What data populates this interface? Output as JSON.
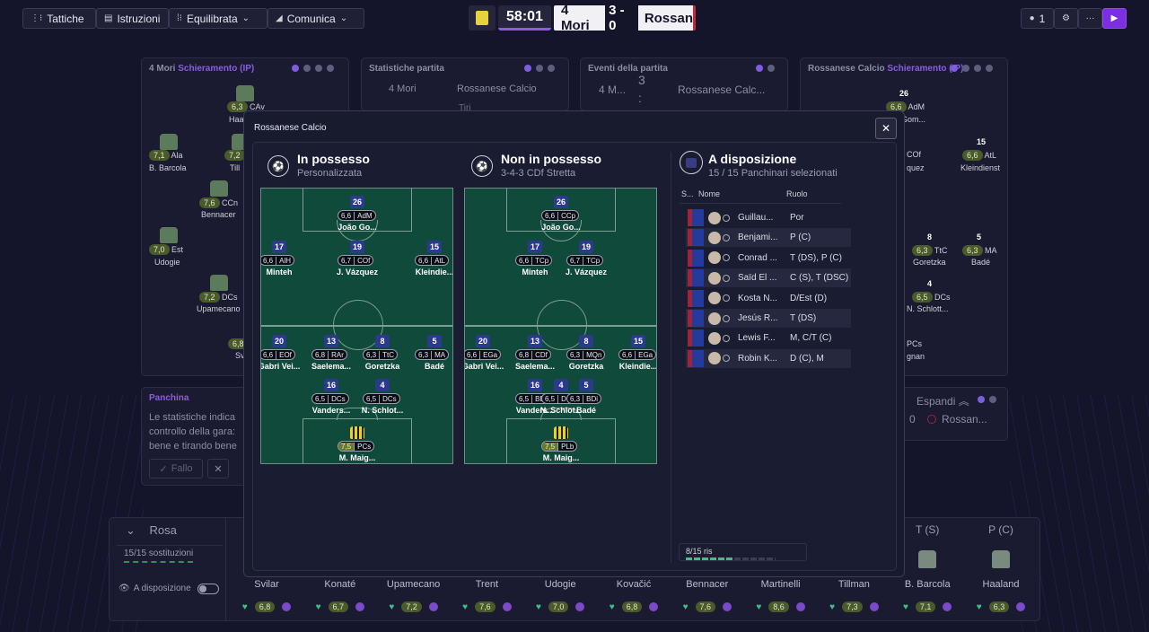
{
  "toolbar": {
    "tactics": "Tattiche",
    "instructions": "Istruzioni",
    "mentality": "Equilibrata",
    "communicate": "Comunica"
  },
  "match": {
    "clock": "58:01",
    "home": "4 Mori",
    "score": "3 - 0",
    "away": "Rossan",
    "users": "1"
  },
  "bg_panels": {
    "home_lineup_team": "4 Mori",
    "home_lineup_title": "Schieramento (IP)",
    "stats_title": "Statistiche partita",
    "stats_home": "4 Mori",
    "stats_away": "Rossanese Calcio",
    "stats_row": "Tiri",
    "events_title": "Eventi della partita",
    "events_home": "4 M...",
    "events_score": "3 : 0",
    "events_away": "Rossanese Calc...",
    "away_lineup_team": "Rossanese Calcio",
    "away_lineup_title": "Schieramento (IP)",
    "bench_title": "Panchina",
    "bench_text": "Le statistiche indica controllo della gara: bene e tirando bene",
    "foul_button": "Fallo",
    "expand": "Espandi",
    "mini_score": "0",
    "mini_team": "Rossan...",
    "home_players": [
      {
        "rating": "6,3",
        "role": "CAv",
        "name": "Haa"
      },
      {
        "rating": "7,1",
        "role": "Ala",
        "name": "B. Barcola"
      },
      {
        "rating": "7,2",
        "role": "Ala",
        "name": "Till"
      },
      {
        "rating": "7,6",
        "role": "CCn",
        "name": "Bennacer"
      },
      {
        "rating": "7,0",
        "role": "Est",
        "name": "Udogie"
      },
      {
        "rating": "7,2",
        "role": "DCs",
        "name": "Upamecano"
      },
      {
        "rating": "6,8",
        "role": "",
        "name": "Sv"
      }
    ],
    "away_players": [
      {
        "rating": "6,6",
        "role": "AdM",
        "name": "Gom...",
        "num": "26"
      },
      {
        "rating": "",
        "role": "COf",
        "name": "quez",
        "num": ""
      },
      {
        "rating": "6,6",
        "role": "AtL",
        "name": "Kleindienst",
        "num": "15"
      },
      {
        "rating": "6,3",
        "role": "TtC",
        "name": "Goretzka",
        "num": "8"
      },
      {
        "rating": "6,3",
        "role": "MA",
        "name": "Badé",
        "num": "5"
      },
      {
        "rating": "6,5",
        "role": "DCs",
        "name": "N. Schlott...",
        "num": "4"
      },
      {
        "rating": "",
        "role": "PCs",
        "name": "gnan",
        "num": ""
      }
    ]
  },
  "modal": {
    "team": "Rossanese Calcio",
    "in_possession": {
      "title": "In possesso",
      "subtitle": "Personalizzata"
    },
    "out_possession": {
      "title": "Non in possesso",
      "subtitle": "3-4-3 CDf Stretta"
    },
    "available": {
      "title": "A disposizione",
      "subtitle": "15 / 15 Panchinari selezionati"
    },
    "table_headers": {
      "shirt": "S...",
      "name": "Nome",
      "role": "Ruolo"
    },
    "subs": [
      {
        "name": "Guillau...",
        "role": "Por"
      },
      {
        "name": "Benjami...",
        "role": "P (C)"
      },
      {
        "name": "Conrad ...",
        "role": "T (DS), P (C)"
      },
      {
        "name": "Saïd El ...",
        "role": "C (S), T (DSC)"
      },
      {
        "name": "Kosta N...",
        "role": "D/Est (D)"
      },
      {
        "name": "Jesús R...",
        "role": "T (DS)"
      },
      {
        "name": "Lewis F...",
        "role": "M, C/T (C)"
      },
      {
        "name": "Robin K...",
        "role": "D (C), M"
      }
    ],
    "reserve_label": "8/15 ris",
    "reserve_fill": 0.53,
    "pitch_in": [
      {
        "num": "26",
        "rating": "6,6",
        "role": "AdM",
        "name": "João Go..."
      },
      {
        "num": "17",
        "rating": "6,6",
        "role": "AlH",
        "name": "Minteh"
      },
      {
        "num": "19",
        "rating": "6,7",
        "role": "COf",
        "name": "J. Vázquez"
      },
      {
        "num": "15",
        "rating": "6,6",
        "role": "AtL",
        "name": "Kleindie..."
      },
      {
        "num": "20",
        "rating": "6,6",
        "role": "EOf",
        "name": "Gabri Vei..."
      },
      {
        "num": "13",
        "rating": "6,8",
        "role": "RAr",
        "name": "Saelema..."
      },
      {
        "num": "8",
        "rating": "6,3",
        "role": "TtC",
        "name": "Goretzka"
      },
      {
        "num": "5",
        "rating": "6,3",
        "role": "MA",
        "name": "Badé"
      },
      {
        "num": "16",
        "rating": "6,5",
        "role": "DCs",
        "name": "Vanders..."
      },
      {
        "num": "4",
        "rating": "6,5",
        "role": "DCs",
        "name": "N. Schlot..."
      },
      {
        "num": "",
        "rating": "7,5",
        "role": "PCs",
        "name": "M. Maig..."
      }
    ],
    "pitch_out": [
      {
        "num": "26",
        "rating": "6,6",
        "role": "CCp",
        "name": "João Go..."
      },
      {
        "num": "17",
        "rating": "6,6",
        "role": "TCp",
        "name": "Minteh"
      },
      {
        "num": "19",
        "rating": "6,7",
        "role": "TCp",
        "name": "J. Vázquez"
      },
      {
        "num": "20",
        "rating": "6,6",
        "role": "EGa",
        "name": "Gabri Vei..."
      },
      {
        "num": "13",
        "rating": "6,8",
        "role": "CDf",
        "name": "Saelema..."
      },
      {
        "num": "8",
        "rating": "6,3",
        "role": "MQn",
        "name": "Goretzka"
      },
      {
        "num": "15",
        "rating": "6,6",
        "role": "EGa",
        "name": "Kleindie..."
      },
      {
        "num": "16",
        "rating": "6,5",
        "role": "BDi",
        "name": "Vanders..."
      },
      {
        "num": "4",
        "rating": "6,5",
        "role": "DC",
        "name": "N. Schlot..."
      },
      {
        "num": "5",
        "rating": "6,3",
        "role": "BDi",
        "name": "Badé"
      },
      {
        "num": "",
        "rating": "7,5",
        "role": "PLb",
        "name": "M. Maig..."
      }
    ]
  },
  "squad": {
    "title": "Rosa",
    "subs_used": "15/15 sostituzioni",
    "available_toggle": "A disposizione",
    "cols": [
      {
        "name": "Svilar",
        "rating": "6,8",
        "pos": ""
      },
      {
        "name": "Konaté",
        "rating": "6,7",
        "pos": ""
      },
      {
        "name": "Upamecano",
        "rating": "7,2",
        "pos": ""
      },
      {
        "name": "Trent",
        "rating": "7,6",
        "pos": ""
      },
      {
        "name": "Udogie",
        "rating": "7,0",
        "pos": ""
      },
      {
        "name": "Kovačić",
        "rating": "6,8",
        "pos": ""
      },
      {
        "name": "Bennacer",
        "rating": "7,6",
        "pos": ""
      },
      {
        "name": "Martinelli",
        "rating": "8,6",
        "pos": ""
      },
      {
        "name": "Tillman",
        "rating": "7,3",
        "pos": ""
      },
      {
        "name": "B. Barcola",
        "rating": "7,1",
        "pos": "T (S)"
      },
      {
        "name": "Haaland",
        "rating": "6,3",
        "pos": "P (C)"
      }
    ]
  },
  "colors": {
    "accent": "#7b2fe0",
    "pitch": "#0f4a3a",
    "home_shirt": "#2c3a8c",
    "away_stripe": "#a0233a"
  }
}
